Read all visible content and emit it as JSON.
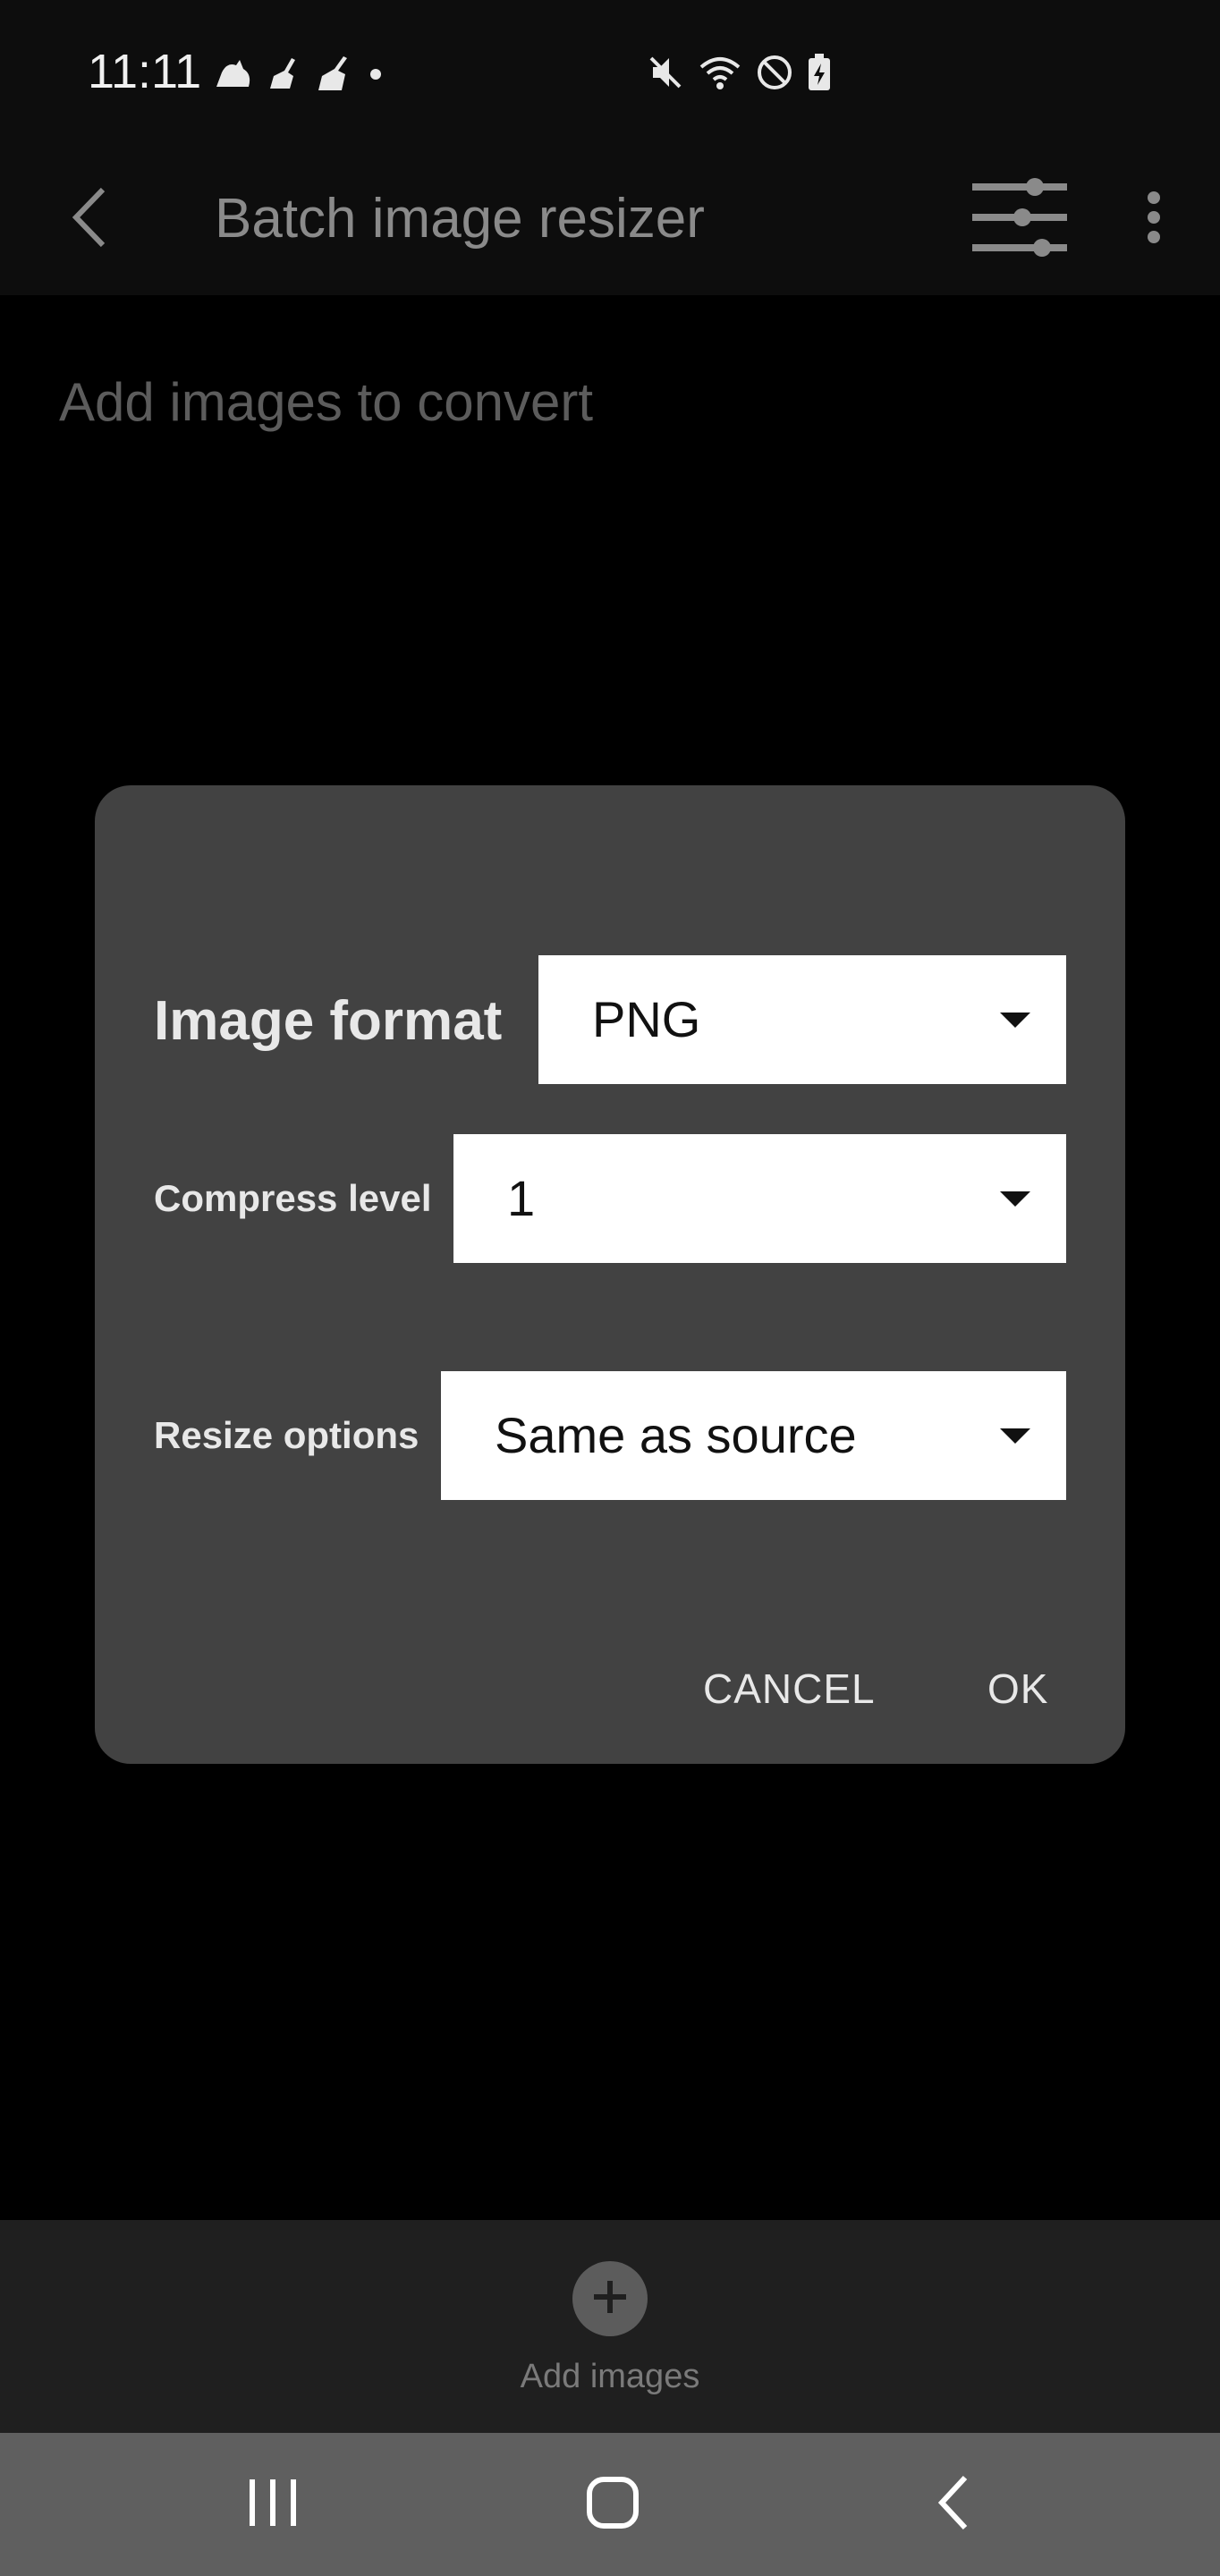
{
  "status_bar": {
    "time": "11:11",
    "left_icons": [
      "cloud-icon",
      "broom-icon",
      "broom-icon",
      "dot-icon"
    ],
    "right_icons": [
      "mute-icon",
      "wifi-icon",
      "block-icon",
      "battery-charging-icon"
    ]
  },
  "app_bar": {
    "title": "Batch image resizer",
    "back_icon": "back-arrow-icon",
    "tune_icon": "tune-sliders-icon",
    "more_icon": "more-vert-icon"
  },
  "content": {
    "empty_hint": "Add images to convert"
  },
  "dialog": {
    "image_format_label": "Image format",
    "image_format_value": "PNG",
    "compress_level_label": "Compress level",
    "compress_level_value": "1",
    "resize_options_label": "Resize options",
    "resize_options_value": "Same as source",
    "cancel_label": "CANCEL",
    "ok_label": "OK"
  },
  "bottom": {
    "add_images_label": "Add images",
    "add_icon": "add-circle-icon"
  },
  "nav_bar": {
    "icons": [
      "recents-icon",
      "home-icon",
      "back-icon"
    ]
  },
  "colors": {
    "background": "#000000",
    "app_bar": "#0d0d0d",
    "dialog": "#424242",
    "select_background": "#ffffff",
    "bottom_area": "#1f1f1f",
    "nav_bar": "#5f5f5f"
  }
}
